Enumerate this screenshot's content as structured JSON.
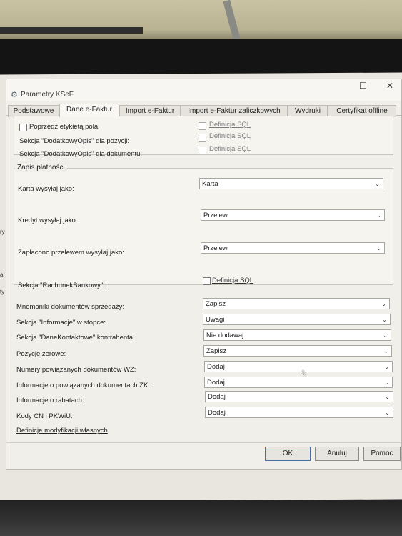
{
  "window": {
    "title": "Parametry KSeF",
    "title_icon": "gear-icon",
    "maximize_glyph": "☐",
    "close_glyph": "✕"
  },
  "tabs": [
    {
      "label": "Podstawowe",
      "active": false
    },
    {
      "label": "Dane e-Faktur",
      "active": true
    },
    {
      "label": "Import e-Faktur",
      "active": false
    },
    {
      "label": "Import e-Faktur zaliczkowych",
      "active": false
    },
    {
      "label": "Wydruki",
      "active": false
    },
    {
      "label": "Certyfikat offline",
      "active": false
    }
  ],
  "top_section": {
    "poprzedz_label": "Poprzedź etykietą pola",
    "poprzedz_checked": false,
    "rows": [
      {
        "label": "",
        "link": "Definicja SQL"
      },
      {
        "label": "Sekcja \"DodatkowyOpis\" dla pozycji:",
        "link": "Definicja SQL"
      },
      {
        "label": "Sekcja \"DodatkowyOpis\" dla dokumentu:",
        "link": "Definicja SQL"
      }
    ]
  },
  "payments": {
    "legend": "Zapis płatności",
    "karta_label": "Karta wysyłaj jako:",
    "karta_value": "Karta",
    "kredyt_label": "Kredyt wysyłaj jako:",
    "kredyt_value": "Przelew",
    "przelew_label": "Zapłacono przelewem wysyłaj jako:",
    "przelew_value": "Przelew",
    "rachunek_label": "Sekcja \"RachunekBankowy\":",
    "rachunek_link": "Definicja SQL"
  },
  "settings": [
    {
      "label": "Mnemoniki dokumentów sprzedaży:",
      "value": "Zapisz"
    },
    {
      "label": "Sekcja \"Informacje\" w stopce:",
      "value": "Uwagi"
    },
    {
      "label": "Sekcja \"DaneKontaktowe\" kontrahenta:",
      "value": "Nie dodawaj"
    },
    {
      "label": "Pozycje zerowe:",
      "value": "Zapisz"
    },
    {
      "label": "Numery powiązanych dokumentów WZ:",
      "value": "Dodaj"
    },
    {
      "label": "Informacje o powiązanych dokumentach ZK:",
      "value": "Dodaj"
    },
    {
      "label": "Informacje o rabatach:",
      "value": "Dodaj"
    },
    {
      "label": "Kody CN i PKWiU:",
      "value": "Dodaj"
    }
  ],
  "custom_mod_link": "Definicje modyfikacji własnych",
  "buttons": {
    "ok": "OK",
    "cancel": "Anuluj",
    "help": "Pomoc"
  },
  "edge_fragments": [
    "ry",
    "a",
    "ty"
  ],
  "colors": {
    "dialog_bg": "#f1efe9",
    "link_disabled": "#7c7c7c",
    "ok_border": "#4b6ea3"
  }
}
